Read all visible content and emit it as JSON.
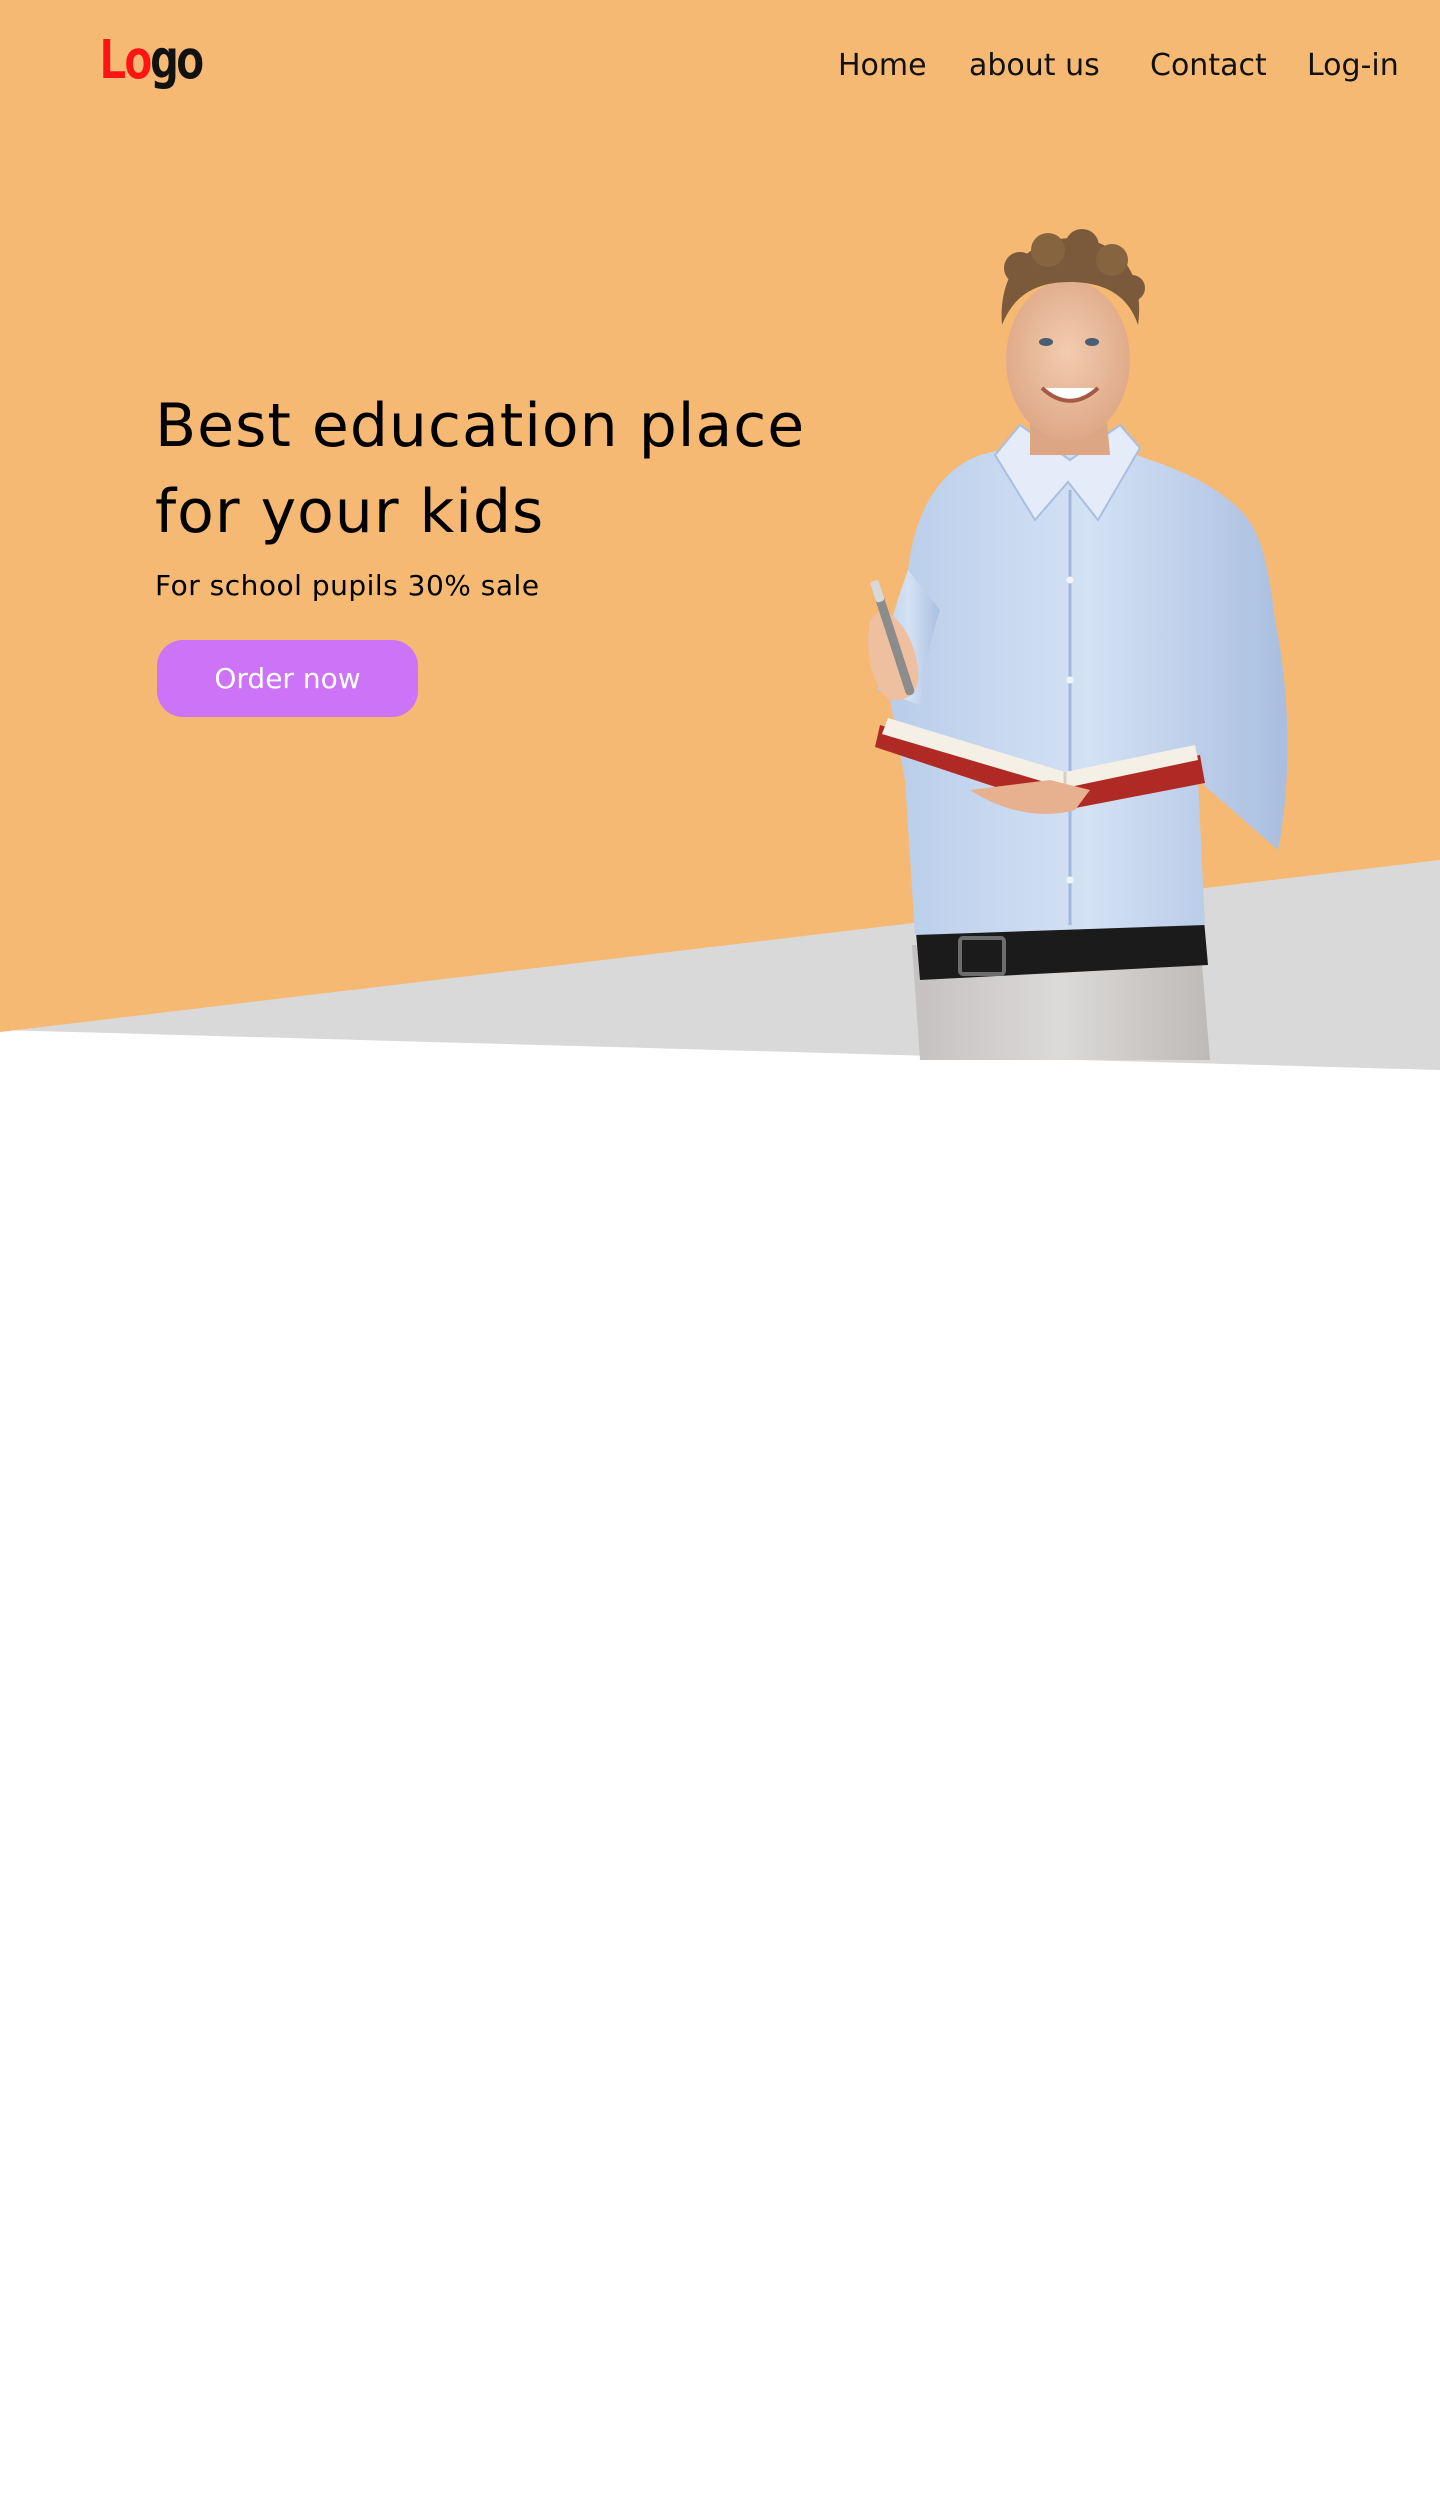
{
  "header": {
    "logo": {
      "part1": "Lo",
      "part2": "go"
    },
    "nav": {
      "home": "Home",
      "about": "about us",
      "contact": "Contact",
      "login": "Log-in"
    }
  },
  "hero": {
    "headline_line1": "Best education place",
    "headline_line2": "for your kids",
    "subtitle": "For school pupils 30% sale",
    "cta_label": "Order now",
    "image_subject": "teacher holding open red book and pen",
    "colors": {
      "background": "#f5b974",
      "band": "#d9d9d9",
      "cta": "#cc73f7",
      "logo_accent": "#ff1414"
    }
  }
}
